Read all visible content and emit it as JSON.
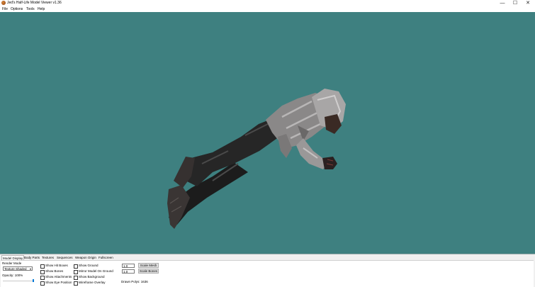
{
  "window": {
    "title": "Jed's Half-Life Model Viewer v1.36",
    "minimize": "—",
    "maximize": "☐",
    "close": "✕"
  },
  "menu": [
    "File",
    "Options",
    "Tools",
    "Help"
  ],
  "viewport": {
    "background": "#3e8080"
  },
  "tabs": [
    "Model Display",
    "Body Parts",
    "Textures",
    "Sequences",
    "Weapon Origin",
    "Fullscreen"
  ],
  "model_display": {
    "render_mode_label": "Render Mode",
    "render_mode_value": "Texture Shaded",
    "opacity_label": "Opacity: 100%",
    "opacity_fraction": 1.0,
    "checkboxes_col1": [
      "Show Hit Boxes",
      "Show Bones",
      "Show Attachments",
      "Show Eye Position"
    ],
    "checkboxes_col2": [
      "Show Ground",
      "Mirror Model On Ground",
      "Show Background",
      "Wireframe Overlay"
    ],
    "scale_mesh_value": "1.0",
    "scale_bones_value": "1.0",
    "scale_mesh_button": "Scale Mesh",
    "scale_bones_button": "Scale Bones",
    "drawn_polys": "Drawn Polys: 1636"
  }
}
